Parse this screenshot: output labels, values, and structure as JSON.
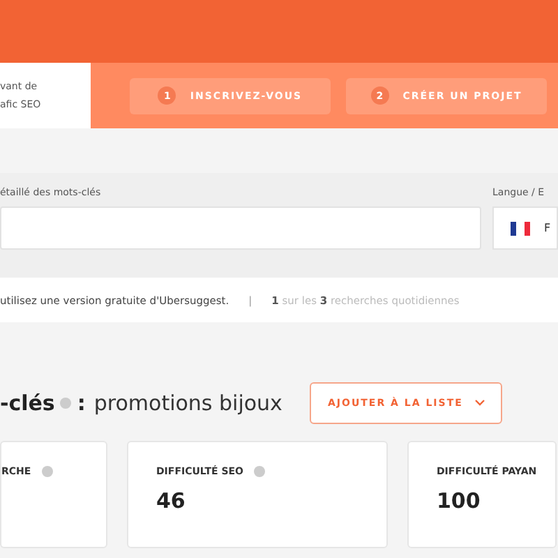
{
  "promo": {
    "lines": [
      "vant de",
      "afic SEO"
    ]
  },
  "steps": [
    {
      "number": "1",
      "label": "INSCRIVEZ-VOUS"
    },
    {
      "number": "2",
      "label": "CRÉER UN PROJET"
    }
  ],
  "search": {
    "label": "étaillé des mots-clés",
    "language_label": "Langue / E",
    "language_value": "F"
  },
  "notice": {
    "text": "utilisez une version gratuite d'Ubersuggest.",
    "separator": "|",
    "quota": "**1** sur les **3** recherches quotidiennes"
  },
  "heading": {
    "prefix": "-clés",
    "separator": ":",
    "keyword": "promotions bijoux",
    "button": "AJOUTER À LA LISTE"
  },
  "cards": [
    {
      "title": "RCHE"
    },
    {
      "title": "DIFFICULTÉ SEO",
      "value": "46"
    },
    {
      "title": "DIFFICULTÉ PAYAN",
      "value": "100"
    }
  ]
}
